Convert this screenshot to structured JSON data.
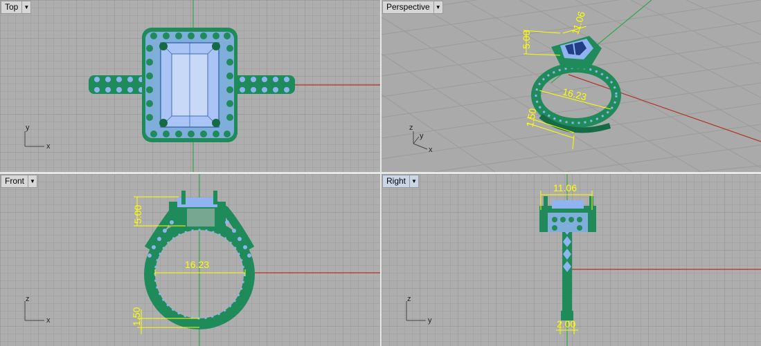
{
  "viewports": {
    "top": {
      "label": "Top",
      "axis_v": "y",
      "axis_h": "x"
    },
    "perspective": {
      "label": "Perspective",
      "axis_v": "z",
      "axis_h": "x",
      "axis_d": "y"
    },
    "front": {
      "label": "Front",
      "axis_v": "z",
      "axis_h": "x"
    },
    "right": {
      "label": "Right",
      "axis_v": "z",
      "axis_h": "y"
    }
  },
  "dimensions": {
    "persp_width": "11.06",
    "persp_height": "5.00",
    "persp_diameter": "16.23",
    "persp_band": "1.50",
    "front_height": "5.00",
    "front_diameter": "16.23",
    "front_band": "1.50",
    "right_width": "11.06",
    "right_band": "2.00"
  },
  "icons": {
    "dropdown": "chevron-down-icon"
  },
  "colors": {
    "viewport_bg": "#aeaeae",
    "grid": "#9c9c9c",
    "metal": "#1f8a5a",
    "stone": "#8fb4f0",
    "dimension": "#ffff00",
    "x_axis": "#b0322a",
    "y_axis": "#2fa84a",
    "active_tab": "#c9d6e8"
  }
}
